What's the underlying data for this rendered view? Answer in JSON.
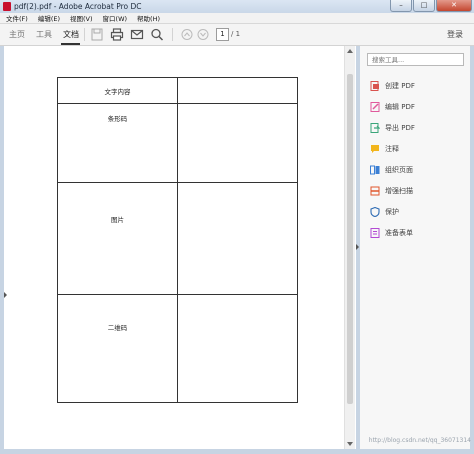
{
  "window": {
    "title": "pdf(2).pdf - Adobe Acrobat Pro DC",
    "minimize": "–",
    "maximize": "□",
    "close": "✕"
  },
  "menu": [
    "文件(F)",
    "编辑(E)",
    "视图(V)",
    "窗口(W)",
    "帮助(H)"
  ],
  "toolbar": {
    "tabs": [
      "主页",
      "工具",
      "文档"
    ],
    "active_tab": "文档",
    "page_current": "1",
    "page_total": "/ 1",
    "sign_in": "登录"
  },
  "document": {
    "rows": [
      {
        "label": "文字内容",
        "value": ""
      },
      {
        "label": "条形码",
        "value": ""
      },
      {
        "label": "图片",
        "value": ""
      },
      {
        "label": "二维码",
        "value": ""
      }
    ]
  },
  "tools_pane": {
    "search_placeholder": "搜索工具...",
    "tools": [
      {
        "label": "创建 PDF",
        "color": "#d9534f"
      },
      {
        "label": "编辑 PDF",
        "color": "#e05a9c"
      },
      {
        "label": "导出 PDF",
        "color": "#3aa57a"
      },
      {
        "label": "注释",
        "color": "#f2b51c"
      },
      {
        "label": "组织页面",
        "color": "#3b7fd4"
      },
      {
        "label": "增强扫描",
        "color": "#e0562b"
      },
      {
        "label": "保护",
        "color": "#2d6bb3"
      },
      {
        "label": "准备表单",
        "color": "#b24ad3"
      }
    ]
  },
  "watermark": "http://blog.csdn.net/qq_36071314"
}
